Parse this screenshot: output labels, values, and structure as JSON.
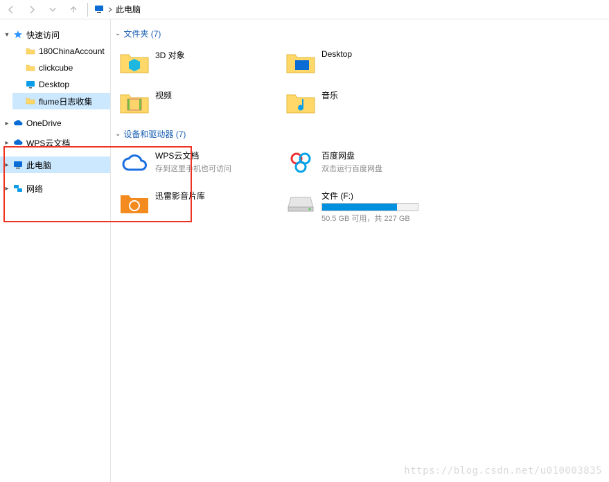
{
  "topbar": {
    "clipped_title": "此电脑"
  },
  "sidebar": {
    "quick_access": "快速访问",
    "quick_items": [
      {
        "label": "180ChinaAccount"
      },
      {
        "label": "clickcube"
      },
      {
        "label": "Desktop"
      },
      {
        "label": "flume日志收集"
      }
    ],
    "onedrive": "OneDrive",
    "wps": "WPS云文档",
    "this_pc": "此电脑",
    "network": "网络"
  },
  "main": {
    "folders": {
      "header": "文件夹 (7)",
      "items": [
        {
          "label": "3D 对象"
        },
        {
          "label": "Desktop"
        },
        {
          "label": "视频"
        },
        {
          "label": "音乐"
        }
      ]
    },
    "devices": {
      "header": "设备和驱动器 (7)",
      "items": [
        {
          "label": "WPS云文档",
          "sub": "存到这里手机也可访问"
        },
        {
          "label": "百度网盘",
          "sub": "双击运行百度网盘"
        },
        {
          "label": "迅雷影音片库",
          "sub": ""
        },
        {
          "label": "文件 (F:)",
          "sub": "50.5 GB 可用，共 227 GB",
          "drive": true,
          "fill_pct": 78
        }
      ]
    }
  },
  "watermark": "https://blog.csdn.net/u010003835"
}
